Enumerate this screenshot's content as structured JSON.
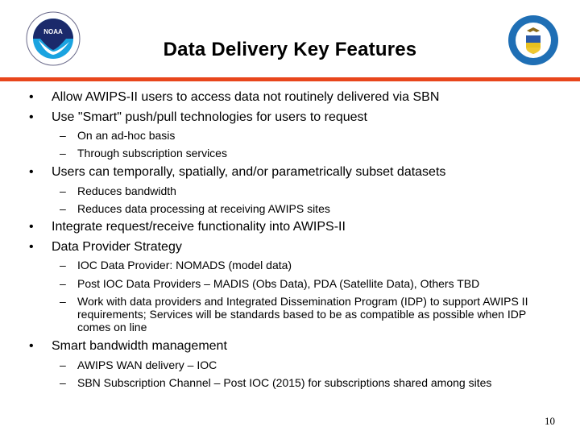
{
  "slide": {
    "title": "Data Delivery Key Features",
    "page_number": "10",
    "accent_color": "#e8461c",
    "logos": {
      "left": "noaa-logo",
      "left_text": "NOAA",
      "right": "department-of-commerce-seal"
    },
    "bullets": [
      {
        "marker": "•",
        "text": "Allow AWIPS-II users to access data not routinely delivered via SBN",
        "sub": []
      },
      {
        "marker": "•",
        "text": "Use \"Smart\" push/pull technologies for users to request",
        "sub": [
          {
            "marker": "–",
            "text": "On an ad-hoc basis"
          },
          {
            "marker": "–",
            "text": "Through subscription services"
          }
        ]
      },
      {
        "marker": "•",
        "text": "Users can temporally, spatially, and/or parametrically subset datasets",
        "sub": [
          {
            "marker": "–",
            "text": "Reduces bandwidth"
          },
          {
            "marker": "–",
            "text": "Reduces data processing at receiving AWIPS sites"
          }
        ]
      },
      {
        "marker": "•",
        "text": "Integrate request/receive functionality into AWIPS-II",
        "sub": []
      },
      {
        "marker": "•",
        "text": "Data Provider Strategy",
        "sub": [
          {
            "marker": "–",
            "text": "IOC Data Provider: NOMADS (model data)"
          },
          {
            "marker": "–",
            "text": "Post IOC Data Providers – MADIS (Obs Data), PDA (Satellite Data),  Others TBD"
          },
          {
            "marker": "–",
            "text": "Work with data providers and Integrated Dissemination Program (IDP) to support AWIPS II requirements; Services will be standards based to be as compatible as possible when IDP comes on line"
          }
        ]
      },
      {
        "marker": "•",
        "text": "Smart bandwidth management",
        "sub": [
          {
            "marker": "–",
            "text": "AWIPS WAN delivery – IOC"
          },
          {
            "marker": "–",
            "text": "SBN Subscription Channel – Post IOC (2015) for subscriptions shared among sites"
          }
        ]
      }
    ]
  }
}
